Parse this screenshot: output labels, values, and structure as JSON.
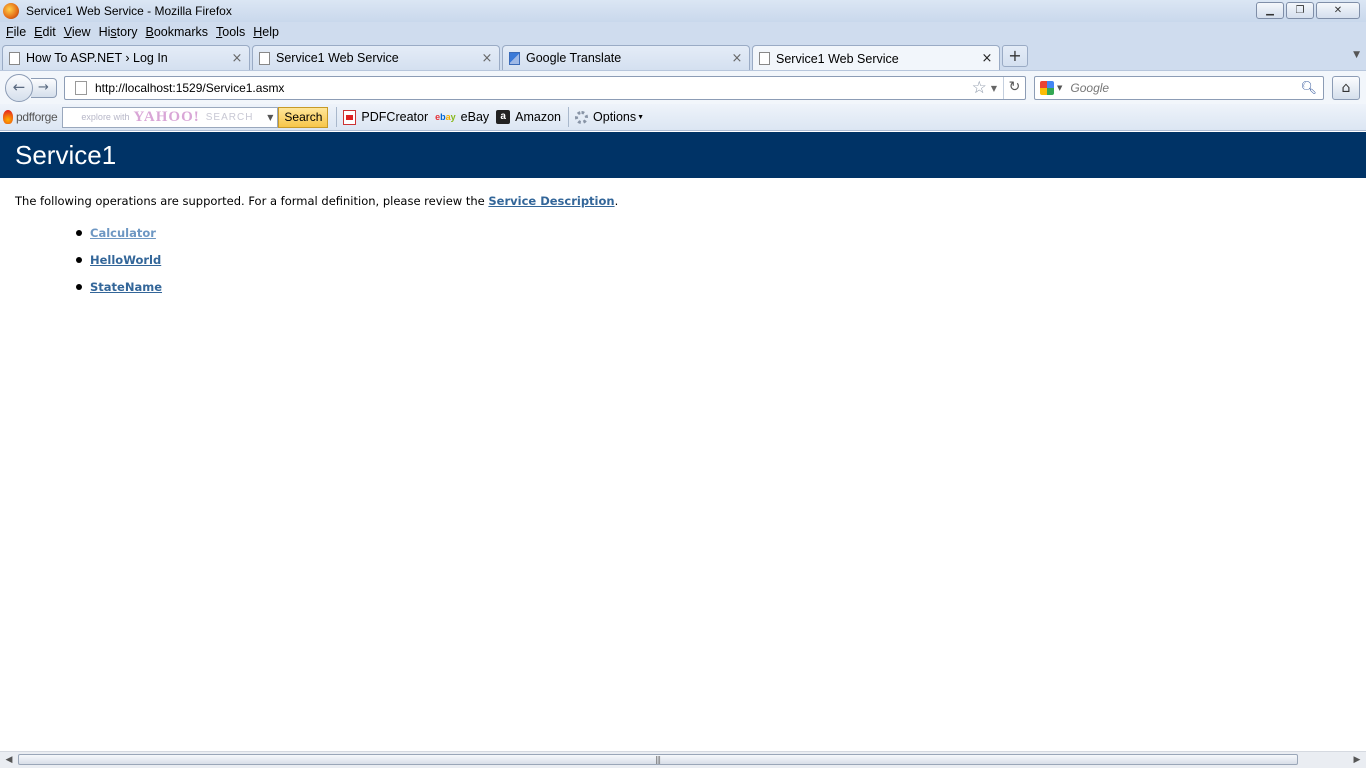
{
  "window": {
    "title": "Service1 Web Service - Mozilla Firefox"
  },
  "menu": {
    "items": [
      {
        "accel": "F",
        "rest": "ile"
      },
      {
        "accel": "E",
        "rest": "dit"
      },
      {
        "accel": "V",
        "rest": "iew"
      },
      {
        "pre": "Hi",
        "accel": "s",
        "rest": "tory"
      },
      {
        "accel": "B",
        "rest": "ookmarks"
      },
      {
        "accel": "T",
        "rest": "ools"
      },
      {
        "accel": "H",
        "rest": "elp"
      }
    ]
  },
  "tabs": [
    {
      "label": "How To ASP.NET › Log In",
      "active": false
    },
    {
      "label": "Service1 Web Service",
      "active": false
    },
    {
      "label": "Google Translate",
      "active": false
    },
    {
      "label": "Service1 Web Service",
      "active": true
    }
  ],
  "newtab": {
    "label": "+"
  },
  "navbar": {
    "url": "http://localhost:1529/Service1.asmx",
    "search_placeholder": "Google"
  },
  "toolbar": {
    "logo_text": "pdfforge",
    "yahoo_placeholder": "explore with",
    "yahoo_brand": "YAHOO!",
    "yahoo_search_word": "SEARCH",
    "search_button": "Search",
    "items": {
      "pdfcreator": "PDFCreator",
      "ebay": "eBay",
      "amazon": "Amazon",
      "options": "Options"
    }
  },
  "page": {
    "title": "Service1",
    "intro_text": "The following operations are supported. For a formal definition, please review the ",
    "service_description_link": "Service Description",
    "intro_end": ".",
    "operations": [
      "Calculator",
      "HelloWorld",
      "StateName"
    ]
  }
}
